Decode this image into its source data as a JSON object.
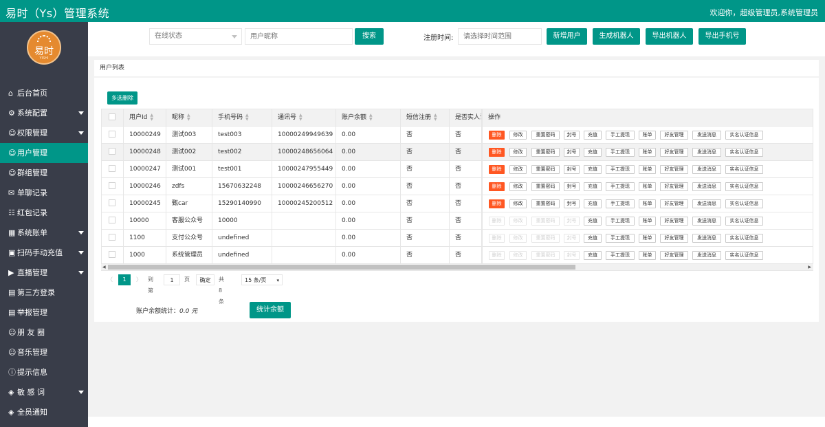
{
  "header": {
    "brand": "易时（Ys）管理系统",
    "welcome": "欢迎你，超级管理员,系统管理员"
  },
  "logo": {
    "text": "易时",
    "subtext": "YISHI"
  },
  "sidebar": {
    "items": [
      {
        "icon": "⌂",
        "label": "后台首页",
        "caret": false,
        "active": false
      },
      {
        "icon": "⚙",
        "label": "系统配置",
        "caret": true,
        "active": false
      },
      {
        "icon": "☺",
        "label": "权限管理",
        "caret": true,
        "active": false
      },
      {
        "icon": "☺",
        "label": "用户管理",
        "caret": false,
        "active": true
      },
      {
        "icon": "☺",
        "label": "群组管理",
        "caret": false,
        "active": false
      },
      {
        "icon": "✉",
        "label": "单聊记录",
        "caret": false,
        "active": false
      },
      {
        "icon": "☷",
        "label": "红包记录",
        "caret": false,
        "active": false
      },
      {
        "icon": "▦",
        "label": "系统账单",
        "caret": true,
        "active": false
      },
      {
        "icon": "▣",
        "label": "扫码手动充值",
        "caret": true,
        "active": false
      },
      {
        "icon": "▶",
        "label": "直播管理",
        "caret": true,
        "active": false
      },
      {
        "icon": "▤",
        "label": "第三方登录",
        "caret": false,
        "active": false
      },
      {
        "icon": "▤",
        "label": "举报管理",
        "caret": false,
        "active": false
      },
      {
        "icon": "☺",
        "label": "朋 友 圈",
        "caret": false,
        "active": false
      },
      {
        "icon": "☺",
        "label": "音乐管理",
        "caret": false,
        "active": false
      },
      {
        "icon": "ⓘ",
        "label": "提示信息",
        "caret": false,
        "active": false
      },
      {
        "icon": "◈",
        "label": "敏 感 词",
        "caret": true,
        "active": false
      },
      {
        "icon": "◈",
        "label": "全员通知",
        "caret": false,
        "active": false
      }
    ]
  },
  "toolbar": {
    "status_select": "在线状态",
    "nickname_placeholder": "用户昵称",
    "search_label": "搜索",
    "reg_time_label": "注册时间:",
    "time_placeholder": "请选择时间范围",
    "add_user": "新增用户",
    "gen_robot": "生成机器人",
    "export_robot": "导出机器人",
    "export_phone": "导出手机号"
  },
  "panel": {
    "title": "用户列表",
    "multi_delete": "多选删除"
  },
  "table": {
    "headers": [
      "用户Id",
      "昵称",
      "手机号码",
      "通讯号",
      "账户余额",
      "短信注册",
      "是否实人认证"
    ],
    "ops_header": "操作",
    "ops": [
      "删除",
      "修改",
      "重置密码",
      "封号",
      "充值",
      "手工提现",
      "账单",
      "好友管理",
      "发送消息",
      "实名认证信息"
    ],
    "rows": [
      {
        "id": "10000249",
        "nick": "测试003",
        "phone": "test003",
        "acct": "10000249949639",
        "bal": "0.00",
        "sms": "否",
        "real": "否",
        "sys": false
      },
      {
        "id": "10000248",
        "nick": "测试002",
        "phone": "test002",
        "acct": "10000248656064",
        "bal": "0.00",
        "sms": "否",
        "real": "否",
        "sys": false
      },
      {
        "id": "10000247",
        "nick": "测试001",
        "phone": "test001",
        "acct": "10000247955449",
        "bal": "0.00",
        "sms": "否",
        "real": "否",
        "sys": false
      },
      {
        "id": "10000246",
        "nick": "zdfs",
        "phone": "15670632248",
        "acct": "10000246656270",
        "bal": "0.00",
        "sms": "否",
        "real": "否",
        "sys": false
      },
      {
        "id": "10000245",
        "nick": "甄car",
        "phone": "15290140990",
        "acct": "10000245200512",
        "bal": "0.00",
        "sms": "否",
        "real": "否",
        "sys": false
      },
      {
        "id": "10000",
        "nick": "客服公众号",
        "phone": "10000",
        "acct": "",
        "bal": "0.00",
        "sms": "否",
        "real": "否",
        "sys": true
      },
      {
        "id": "1100",
        "nick": "支付公众号",
        "phone": "undefined",
        "acct": "",
        "bal": "0.00",
        "sms": "否",
        "real": "否",
        "sys": true
      },
      {
        "id": "1000",
        "nick": "系统管理员",
        "phone": "undefined",
        "acct": "",
        "bal": "0.00",
        "sms": "否",
        "real": "否",
        "sys": true
      }
    ]
  },
  "pager": {
    "current": "1",
    "goto_label": "到第",
    "goto_value": "1",
    "page_unit": "页",
    "confirm": "确定",
    "total": "共 8 条",
    "per_page": "15 条/页"
  },
  "stats": {
    "label": "账户余额统计：",
    "value": "0.0 元",
    "button": "统计余额"
  }
}
